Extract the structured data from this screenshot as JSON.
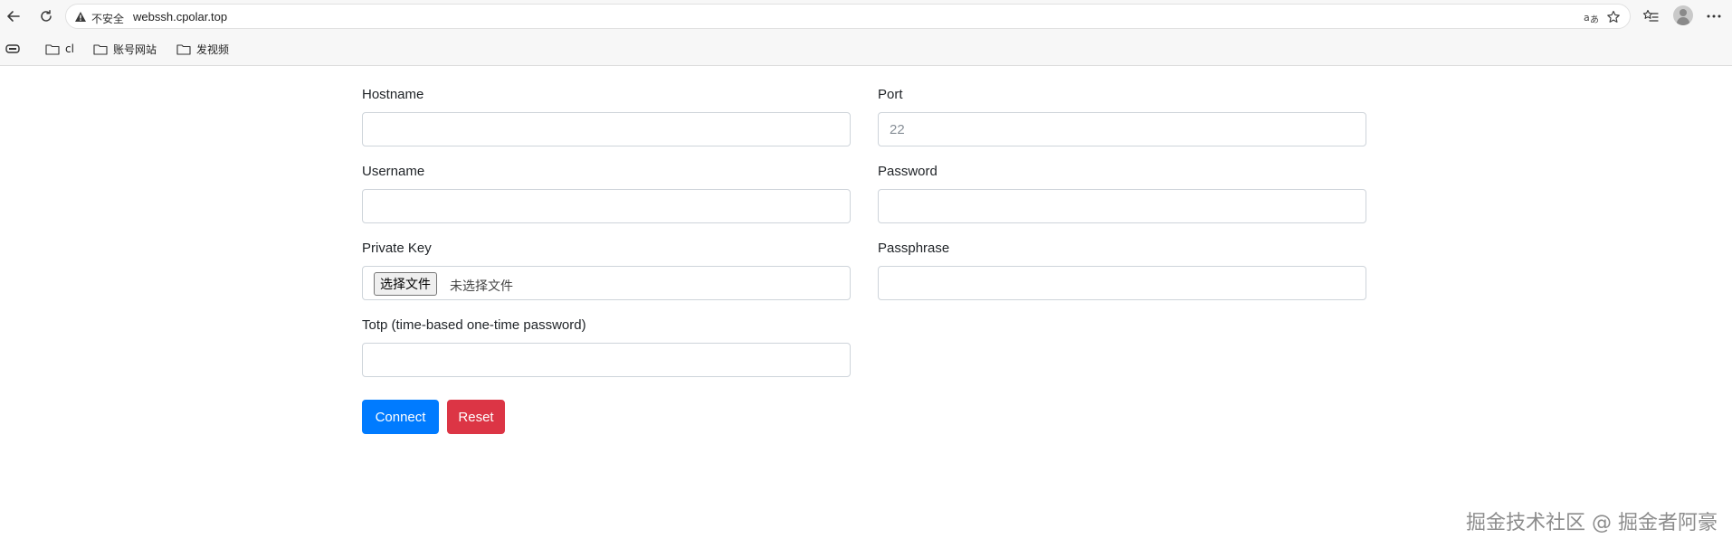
{
  "browser": {
    "address": {
      "security_label": "不安全",
      "url": "webssh.cpolar.top"
    },
    "bookmarks": [
      {
        "label": "cl"
      },
      {
        "label": "账号网站"
      },
      {
        "label": "发视频"
      }
    ]
  },
  "form": {
    "hostname": {
      "label": "Hostname",
      "value": "",
      "placeholder": ""
    },
    "port": {
      "label": "Port",
      "value": "",
      "placeholder": "22"
    },
    "username": {
      "label": "Username",
      "value": "",
      "placeholder": ""
    },
    "password": {
      "label": "Password",
      "value": "",
      "placeholder": ""
    },
    "private_key": {
      "label": "Private Key",
      "button_label": "选择文件",
      "status": "未选择文件"
    },
    "passphrase": {
      "label": "Passphrase",
      "value": "",
      "placeholder": ""
    },
    "totp": {
      "label": "Totp (time-based one-time password)",
      "value": "",
      "placeholder": ""
    },
    "connect_label": "Connect",
    "reset_label": "Reset"
  },
  "colors": {
    "primary": "#007bff",
    "danger": "#dc3545"
  },
  "watermark": "掘金技术社区 @ 掘金者阿豪"
}
